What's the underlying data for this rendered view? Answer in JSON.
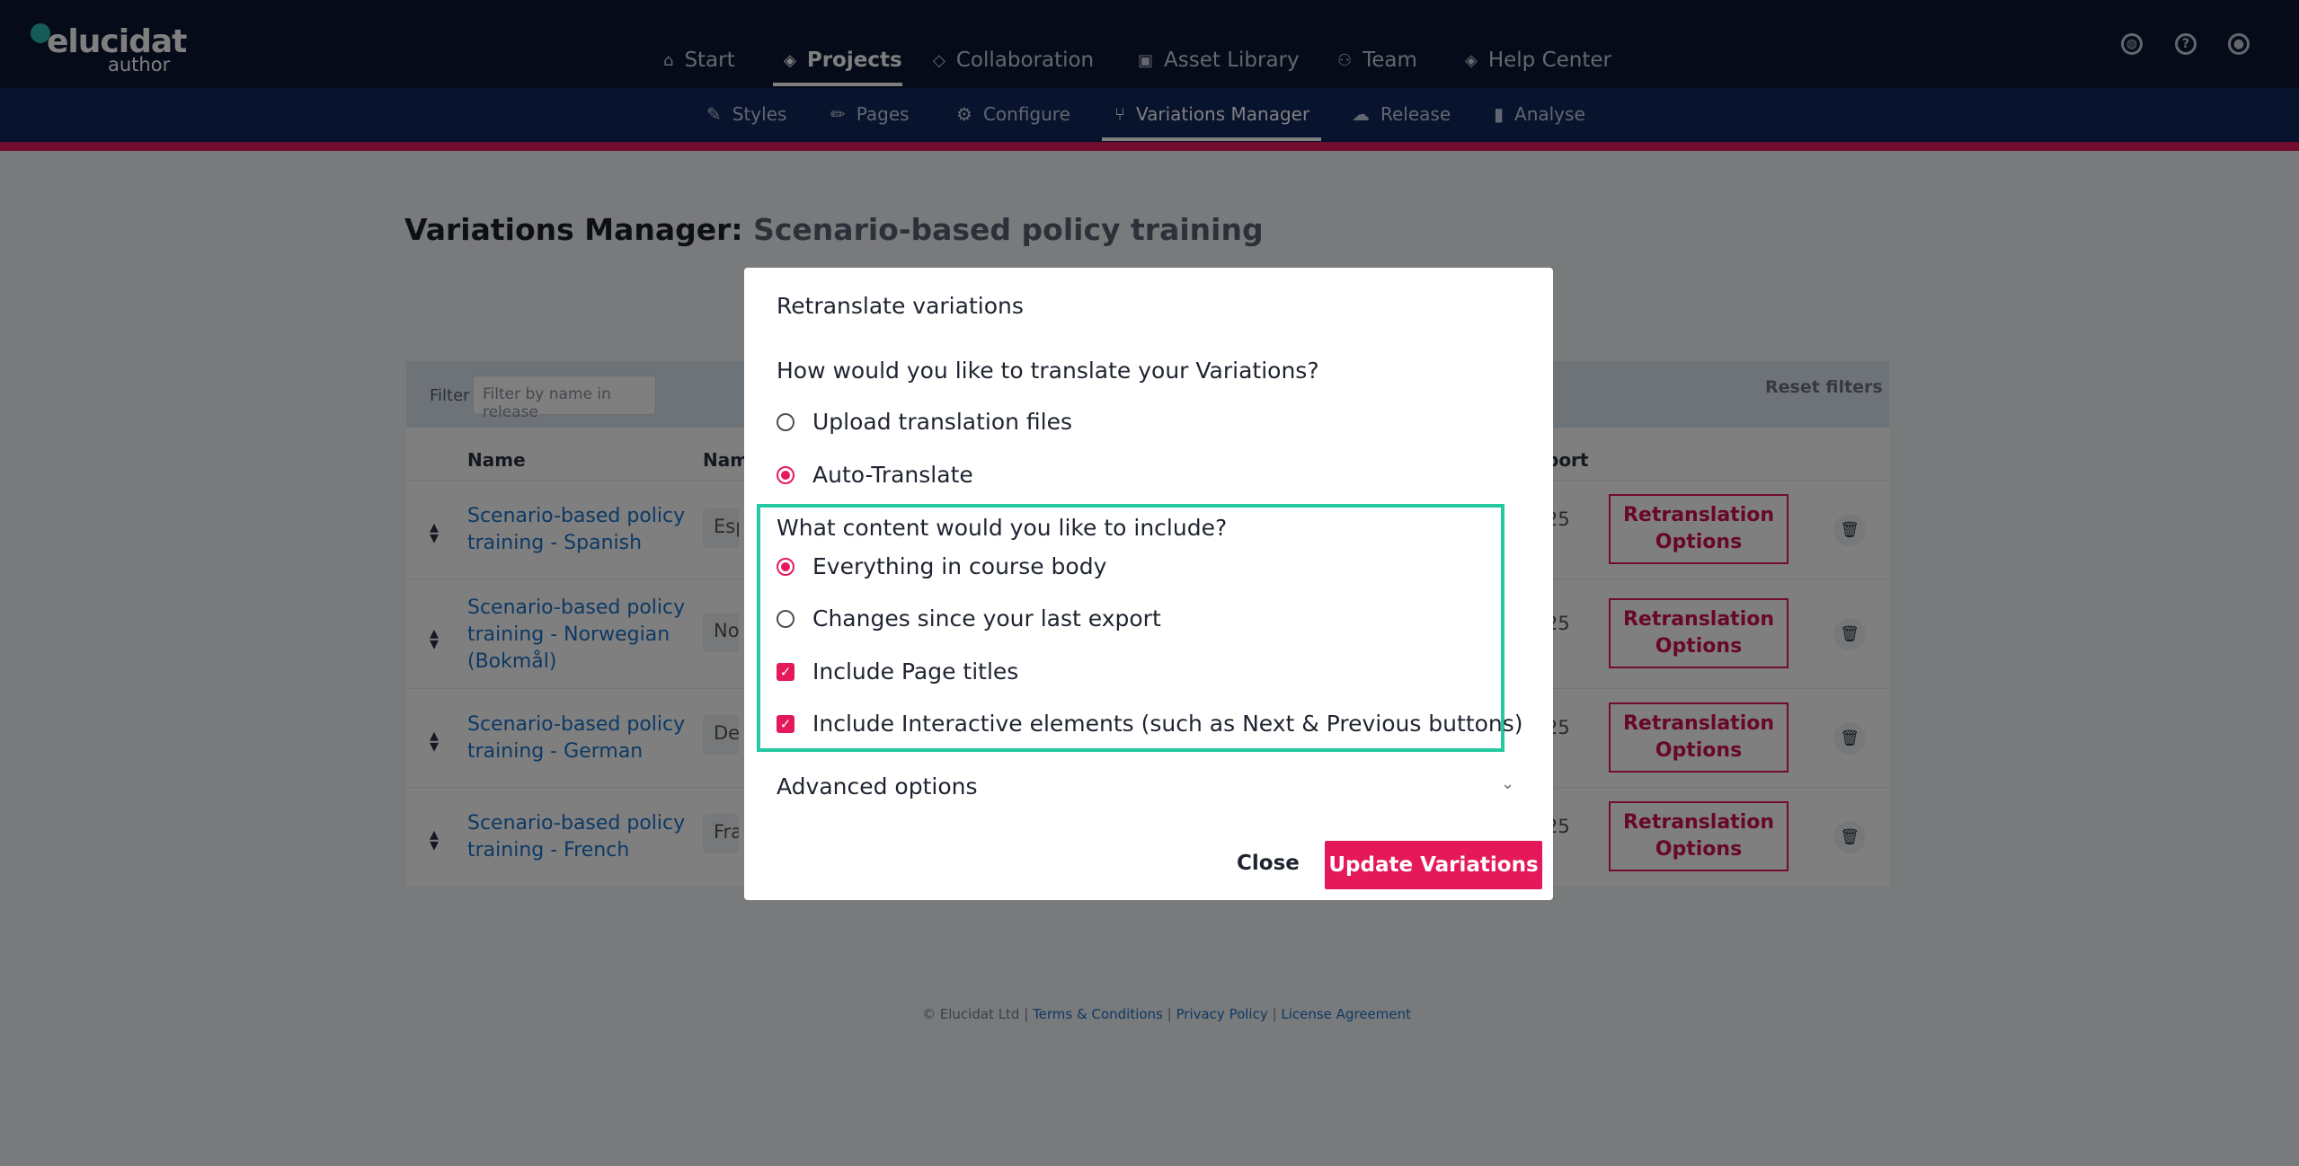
{
  "brand": {
    "name": "elucidat",
    "sub": "author"
  },
  "mainnav": [
    {
      "label": "Start",
      "icon": "home-icon"
    },
    {
      "label": "Projects",
      "icon": "layers-icon",
      "active": true
    },
    {
      "label": "Collaboration",
      "icon": "diamond-icon"
    },
    {
      "label": "Asset Library",
      "icon": "images-icon"
    },
    {
      "label": "Team",
      "icon": "users-icon"
    },
    {
      "label": "Help Center",
      "icon": "help-layers-icon"
    }
  ],
  "topicons": [
    "globe-icon",
    "question-icon",
    "user-icon"
  ],
  "subnav": [
    {
      "label": "Styles",
      "icon": "brush-icon"
    },
    {
      "label": "Pages",
      "icon": "pencil-icon"
    },
    {
      "label": "Configure",
      "icon": "gear-icon"
    },
    {
      "label": "Variations Manager",
      "icon": "branch-icon",
      "active": true
    },
    {
      "label": "Release",
      "icon": "cloud-upload-icon"
    },
    {
      "label": "Analyse",
      "icon": "bar-chart-icon"
    }
  ],
  "page": {
    "title_prefix": "Variations Manager:",
    "title_project": "Scenario-based policy training"
  },
  "filter": {
    "label": "Filter",
    "placeholder": "Filter by name in release",
    "reset": "Reset filters"
  },
  "table": {
    "headers": {
      "name": "Name",
      "name2": "Nam",
      "export": "port"
    },
    "rows": [
      {
        "link": "Scenario-based policy training - Spanish",
        "pill": "Esp",
        "date": "25",
        "action": "Retranslation Options"
      },
      {
        "link": "Scenario-based policy training - Norwegian (Bokmål)",
        "pill": "Nor",
        "date": "25",
        "action": "Retranslation Options"
      },
      {
        "link": "Scenario-based policy training - German",
        "pill": "Deu",
        "date": "25",
        "action": "Retranslation Options"
      },
      {
        "link": "Scenario-based policy training - French",
        "pill": "Fra",
        "date": "25",
        "action": "Retranslation Options"
      }
    ]
  },
  "footer": {
    "copyright": "© Elucidat Ltd |",
    "terms": "Terms & Conditions",
    "privacy": "Privacy Policy",
    "license": "License Agreement",
    "sep": "|"
  },
  "modal": {
    "title": "Retranslate variations",
    "question1": "How would you like to translate your Variations?",
    "option_upload": "Upload translation files",
    "option_auto": "Auto-Translate",
    "question2": "What content would you like to include?",
    "option_everything": "Everything in course body",
    "option_changes": "Changes since your last export",
    "check_page_titles": "Include Page titles",
    "check_interactive": "Include Interactive elements (such as Next & Previous buttons)",
    "advanced": "Advanced options",
    "close": "Close",
    "update": "Update Variations"
  },
  "colors": {
    "brand_pink": "#e5195a",
    "nav_dark": "#0b1733",
    "highlight": "#25c9a0"
  }
}
